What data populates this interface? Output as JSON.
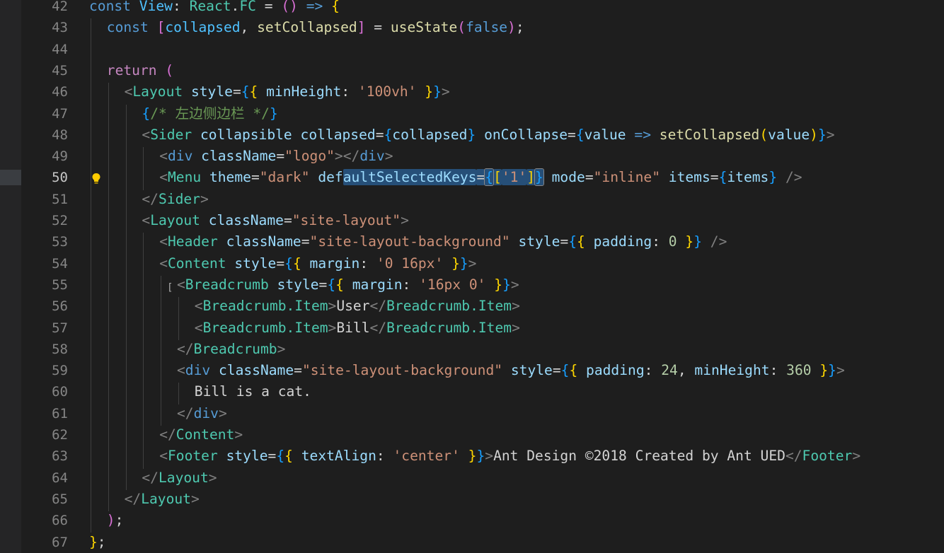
{
  "editor": {
    "theme": "dark",
    "active_line": 50,
    "colors": {
      "background": "#1e1e1e",
      "line_number": "#858585",
      "selection": "#264f78",
      "keyword": "#569cd6",
      "control": "#c586c0",
      "variable": "#9cdcfe",
      "type": "#4ec9b0",
      "function": "#dcdcaa",
      "string": "#ce9178",
      "number": "#b5cea8",
      "comment": "#6a9955"
    }
  },
  "lines": [
    {
      "n": "42",
      "indent": 0,
      "tokens": [
        [
          "kw",
          "const"
        ],
        [
          "text",
          " "
        ],
        [
          "const",
          "View"
        ],
        [
          "text",
          ": "
        ],
        [
          "type",
          "React"
        ],
        [
          "text",
          "."
        ],
        [
          "type",
          "FC"
        ],
        [
          "text",
          " = "
        ],
        [
          "b2",
          "("
        ],
        [
          "b2",
          ")"
        ],
        [
          "text",
          " "
        ],
        [
          "kw",
          "=>"
        ],
        [
          "text",
          " "
        ],
        [
          "b1",
          "{"
        ]
      ]
    },
    {
      "n": "43",
      "indent": 1,
      "tokens": [
        [
          "kw",
          "const"
        ],
        [
          "text",
          " "
        ],
        [
          "b2",
          "["
        ],
        [
          "const",
          "collapsed"
        ],
        [
          "text",
          ", "
        ],
        [
          "fn",
          "setCollapsed"
        ],
        [
          "b2",
          "]"
        ],
        [
          "text",
          " = "
        ],
        [
          "fn",
          "useState"
        ],
        [
          "b2",
          "("
        ],
        [
          "kw",
          "false"
        ],
        [
          "b2",
          ")"
        ],
        [
          "text",
          ";"
        ]
      ]
    },
    {
      "n": "44",
      "indent": 1,
      "tokens": []
    },
    {
      "n": "45",
      "indent": 1,
      "tokens": [
        [
          "ctl",
          "return"
        ],
        [
          "text",
          " "
        ],
        [
          "b2",
          "("
        ]
      ]
    },
    {
      "n": "46",
      "indent": 2,
      "tokens": [
        [
          "angle",
          "<"
        ],
        [
          "tag",
          "Layout"
        ],
        [
          "text",
          " "
        ],
        [
          "attr",
          "style"
        ],
        [
          "text",
          "="
        ],
        [
          "b3",
          "{"
        ],
        [
          "b1",
          "{"
        ],
        [
          "text",
          " "
        ],
        [
          "var",
          "minHeight"
        ],
        [
          "text",
          ": "
        ],
        [
          "str",
          "'100vh'"
        ],
        [
          "text",
          " "
        ],
        [
          "b1",
          "}"
        ],
        [
          "b3",
          "}"
        ],
        [
          "angle",
          ">"
        ]
      ]
    },
    {
      "n": "47",
      "indent": 3,
      "tokens": [
        [
          "b3",
          "{"
        ],
        [
          "cmt",
          "/* 左边侧边栏 */"
        ],
        [
          "b3",
          "}"
        ]
      ]
    },
    {
      "n": "48",
      "indent": 3,
      "tokens": [
        [
          "angle",
          "<"
        ],
        [
          "tag",
          "Sider"
        ],
        [
          "text",
          " "
        ],
        [
          "attr",
          "collapsible"
        ],
        [
          "text",
          " "
        ],
        [
          "attr",
          "collapsed"
        ],
        [
          "text",
          "="
        ],
        [
          "b3",
          "{"
        ],
        [
          "var",
          "collapsed"
        ],
        [
          "b3",
          "}"
        ],
        [
          "text",
          " "
        ],
        [
          "attr",
          "onCollapse"
        ],
        [
          "text",
          "="
        ],
        [
          "b3",
          "{"
        ],
        [
          "var",
          "value"
        ],
        [
          "text",
          " "
        ],
        [
          "kw",
          "=>"
        ],
        [
          "text",
          " "
        ],
        [
          "fn",
          "setCollapsed"
        ],
        [
          "b1",
          "("
        ],
        [
          "var",
          "value"
        ],
        [
          "b1",
          ")"
        ],
        [
          "b3",
          "}"
        ],
        [
          "angle",
          ">"
        ]
      ]
    },
    {
      "n": "49",
      "indent": 4,
      "tokens": [
        [
          "angle",
          "<"
        ],
        [
          "kw",
          "div"
        ],
        [
          "text",
          " "
        ],
        [
          "attr",
          "className"
        ],
        [
          "text",
          "="
        ],
        [
          "str",
          "\"logo\""
        ],
        [
          "angle",
          "></"
        ],
        [
          "kw",
          "div"
        ],
        [
          "angle",
          ">"
        ]
      ]
    },
    {
      "n": "50",
      "indent": 4,
      "tokens": [
        [
          "angle",
          "<"
        ],
        [
          "tag",
          "Menu"
        ],
        [
          "text",
          " "
        ],
        [
          "attr",
          "theme"
        ],
        [
          "text",
          "="
        ],
        [
          "str",
          "\"dark\""
        ],
        [
          "text",
          " "
        ],
        [
          "attr",
          "def"
        ],
        [
          "attrsel",
          "aultSelectedKeys"
        ],
        [
          "textsel",
          "="
        ],
        [
          "b3sel",
          "{"
        ],
        [
          "b1sel",
          "["
        ],
        [
          "strsel",
          "'1'"
        ],
        [
          "b1sel",
          "]"
        ],
        [
          "b3sel",
          "}"
        ],
        [
          "text",
          " "
        ],
        [
          "attr",
          "mode"
        ],
        [
          "text",
          "="
        ],
        [
          "str",
          "\"inline\""
        ],
        [
          "text",
          " "
        ],
        [
          "attr",
          "items"
        ],
        [
          "text",
          "="
        ],
        [
          "b3",
          "{"
        ],
        [
          "var",
          "items"
        ],
        [
          "b3",
          "}"
        ],
        [
          "text",
          " "
        ],
        [
          "angle",
          "/>"
        ]
      ]
    },
    {
      "n": "51",
      "indent": 3,
      "tokens": [
        [
          "angle",
          "</"
        ],
        [
          "tag",
          "Sider"
        ],
        [
          "angle",
          ">"
        ]
      ]
    },
    {
      "n": "52",
      "indent": 3,
      "tokens": [
        [
          "angle",
          "<"
        ],
        [
          "tag",
          "Layout"
        ],
        [
          "text",
          " "
        ],
        [
          "attr",
          "className"
        ],
        [
          "text",
          "="
        ],
        [
          "str",
          "\"site-layout\""
        ],
        [
          "angle",
          ">"
        ]
      ]
    },
    {
      "n": "53",
      "indent": 4,
      "tokens": [
        [
          "angle",
          "<"
        ],
        [
          "tag",
          "Header"
        ],
        [
          "text",
          " "
        ],
        [
          "attr",
          "className"
        ],
        [
          "text",
          "="
        ],
        [
          "str",
          "\"site-layout-background\""
        ],
        [
          "text",
          " "
        ],
        [
          "attr",
          "style"
        ],
        [
          "text",
          "="
        ],
        [
          "b3",
          "{"
        ],
        [
          "b1",
          "{"
        ],
        [
          "text",
          " "
        ],
        [
          "var",
          "padding"
        ],
        [
          "text",
          ": "
        ],
        [
          "num",
          "0"
        ],
        [
          "text",
          " "
        ],
        [
          "b1",
          "}"
        ],
        [
          "b3",
          "}"
        ],
        [
          "text",
          " "
        ],
        [
          "angle",
          "/>"
        ]
      ]
    },
    {
      "n": "54",
      "indent": 4,
      "tokens": [
        [
          "angle",
          "<"
        ],
        [
          "tag",
          "Content"
        ],
        [
          "text",
          " "
        ],
        [
          "attr",
          "style"
        ],
        [
          "text",
          "="
        ],
        [
          "b3",
          "{"
        ],
        [
          "b1",
          "{"
        ],
        [
          "text",
          " "
        ],
        [
          "var",
          "margin"
        ],
        [
          "text",
          ": "
        ],
        [
          "str",
          "'0 16px'"
        ],
        [
          "text",
          " "
        ],
        [
          "b1",
          "}"
        ],
        [
          "b3",
          "}"
        ],
        [
          "angle",
          ">"
        ]
      ]
    },
    {
      "n": "55",
      "indent": 5,
      "tokens": [
        [
          "angle",
          "<"
        ],
        [
          "tag",
          "Breadcrumb"
        ],
        [
          "text",
          " "
        ],
        [
          "attr",
          "style"
        ],
        [
          "text",
          "="
        ],
        [
          "b3",
          "{"
        ],
        [
          "b1",
          "{"
        ],
        [
          "text",
          " "
        ],
        [
          "var",
          "margin"
        ],
        [
          "text",
          ": "
        ],
        [
          "str",
          "'16px 0'"
        ],
        [
          "text",
          " "
        ],
        [
          "b1",
          "}"
        ],
        [
          "b3",
          "}"
        ],
        [
          "angle",
          ">"
        ]
      ]
    },
    {
      "n": "56",
      "indent": 6,
      "tokens": [
        [
          "angle",
          "<"
        ],
        [
          "tag",
          "Breadcrumb.Item"
        ],
        [
          "angle",
          ">"
        ],
        [
          "text",
          "User"
        ],
        [
          "angle",
          "</"
        ],
        [
          "tag",
          "Breadcrumb.Item"
        ],
        [
          "angle",
          ">"
        ]
      ]
    },
    {
      "n": "57",
      "indent": 6,
      "tokens": [
        [
          "angle",
          "<"
        ],
        [
          "tag",
          "Breadcrumb.Item"
        ],
        [
          "angle",
          ">"
        ],
        [
          "text",
          "Bill"
        ],
        [
          "angle",
          "</"
        ],
        [
          "tag",
          "Breadcrumb.Item"
        ],
        [
          "angle",
          ">"
        ]
      ]
    },
    {
      "n": "58",
      "indent": 5,
      "tokens": [
        [
          "angle",
          "</"
        ],
        [
          "tag",
          "Breadcrumb"
        ],
        [
          "angle",
          ">"
        ]
      ]
    },
    {
      "n": "59",
      "indent": 5,
      "tokens": [
        [
          "angle",
          "<"
        ],
        [
          "kw",
          "div"
        ],
        [
          "text",
          " "
        ],
        [
          "attr",
          "className"
        ],
        [
          "text",
          "="
        ],
        [
          "str",
          "\"site-layout-background\""
        ],
        [
          "text",
          " "
        ],
        [
          "attr",
          "style"
        ],
        [
          "text",
          "="
        ],
        [
          "b3",
          "{"
        ],
        [
          "b1",
          "{"
        ],
        [
          "text",
          " "
        ],
        [
          "var",
          "padding"
        ],
        [
          "text",
          ": "
        ],
        [
          "num",
          "24"
        ],
        [
          "text",
          ", "
        ],
        [
          "var",
          "minHeight"
        ],
        [
          "text",
          ": "
        ],
        [
          "num",
          "360"
        ],
        [
          "text",
          " "
        ],
        [
          "b1",
          "}"
        ],
        [
          "b3",
          "}"
        ],
        [
          "angle",
          ">"
        ]
      ]
    },
    {
      "n": "60",
      "indent": 6,
      "tokens": [
        [
          "text",
          "Bill is a cat."
        ]
      ]
    },
    {
      "n": "61",
      "indent": 5,
      "tokens": [
        [
          "angle",
          "</"
        ],
        [
          "kw",
          "div"
        ],
        [
          "angle",
          ">"
        ]
      ]
    },
    {
      "n": "62",
      "indent": 4,
      "tokens": [
        [
          "angle",
          "</"
        ],
        [
          "tag",
          "Content"
        ],
        [
          "angle",
          ">"
        ]
      ]
    },
    {
      "n": "63",
      "indent": 4,
      "tokens": [
        [
          "angle",
          "<"
        ],
        [
          "tag",
          "Footer"
        ],
        [
          "text",
          " "
        ],
        [
          "attr",
          "style"
        ],
        [
          "text",
          "="
        ],
        [
          "b3",
          "{"
        ],
        [
          "b1",
          "{"
        ],
        [
          "text",
          " "
        ],
        [
          "var",
          "textAlign"
        ],
        [
          "text",
          ": "
        ],
        [
          "str",
          "'center'"
        ],
        [
          "text",
          " "
        ],
        [
          "b1",
          "}"
        ],
        [
          "b3",
          "}"
        ],
        [
          "angle",
          ">"
        ],
        [
          "text",
          "Ant Design ©2018 Created by Ant UED"
        ],
        [
          "angle",
          "</"
        ],
        [
          "tag",
          "Footer"
        ],
        [
          "angle",
          ">"
        ]
      ]
    },
    {
      "n": "64",
      "indent": 3,
      "tokens": [
        [
          "angle",
          "</"
        ],
        [
          "tag",
          "Layout"
        ],
        [
          "angle",
          ">"
        ]
      ]
    },
    {
      "n": "65",
      "indent": 2,
      "tokens": [
        [
          "angle",
          "</"
        ],
        [
          "tag",
          "Layout"
        ],
        [
          "angle",
          ">"
        ]
      ]
    },
    {
      "n": "66",
      "indent": 1,
      "tokens": [
        [
          "b2",
          ")"
        ],
        [
          "text",
          ";"
        ]
      ]
    },
    {
      "n": "67",
      "indent": 0,
      "tokens": [
        [
          "b1",
          "}"
        ],
        [
          "text",
          ";"
        ]
      ]
    }
  ]
}
